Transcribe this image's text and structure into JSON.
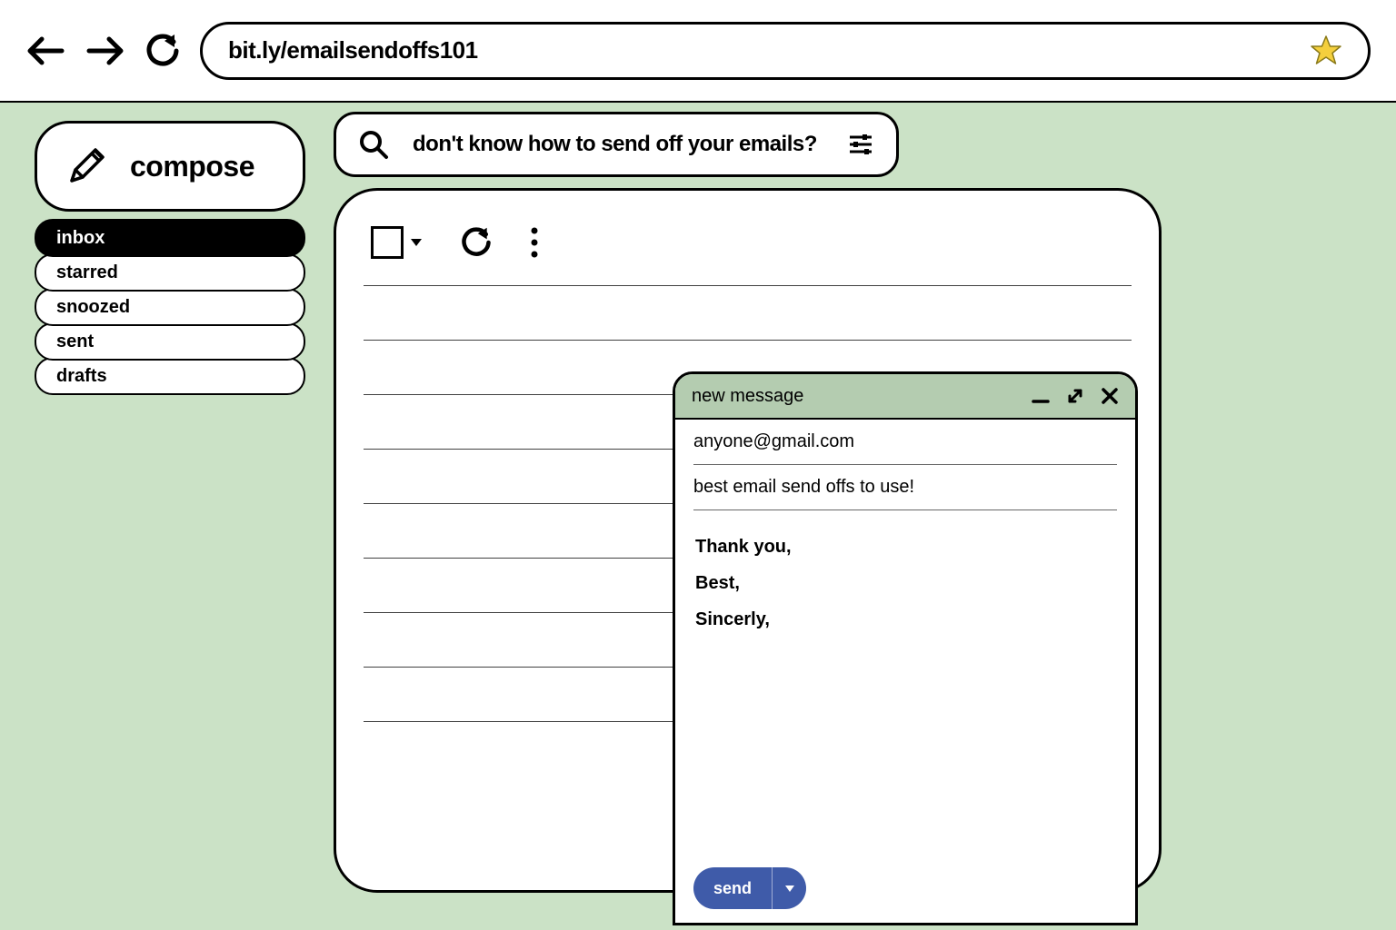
{
  "browser": {
    "url": "bit.ly/emailsendoffs101"
  },
  "compose_button": {
    "label": "compose"
  },
  "sidebar": {
    "items": [
      {
        "label": "inbox",
        "active": true
      },
      {
        "label": "starred",
        "active": false
      },
      {
        "label": "snoozed",
        "active": false
      },
      {
        "label": "sent",
        "active": false
      },
      {
        "label": "drafts",
        "active": false
      }
    ]
  },
  "search": {
    "query": "don't know how to send off your emails?"
  },
  "inbox": {
    "row_count": 9
  },
  "compose_window": {
    "title": "new message",
    "to": "anyone@gmail.com",
    "subject": "best email send offs to use!",
    "body_lines": [
      "Thank you,",
      "Best,",
      "Sincerly,"
    ],
    "send_label": "send"
  },
  "colors": {
    "page_bg": "#cbe2c6",
    "compose_header_bg": "#b4ccb0",
    "send_button": "#3f5ba9",
    "star_fill": "#f4cf3d"
  }
}
